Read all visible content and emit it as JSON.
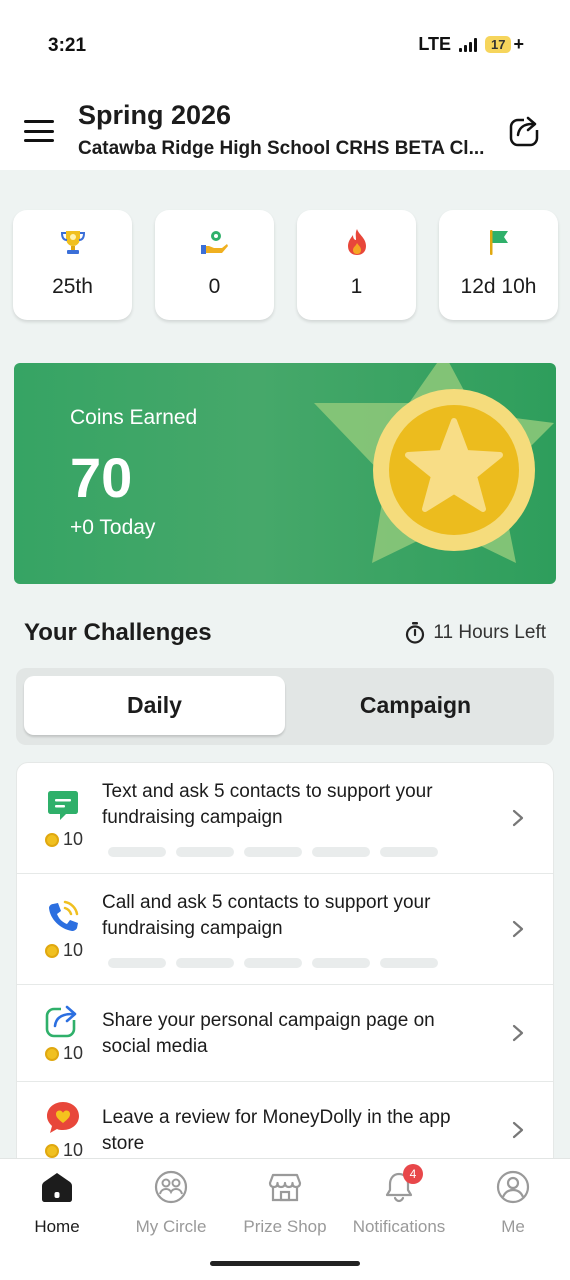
{
  "status_bar": {
    "time": "3:21",
    "network": "LTE",
    "battery": "17",
    "battery_suffix": "+"
  },
  "header": {
    "title": "Spring 2026",
    "subtitle": "Catawba Ridge High School CRHS BETA Cl...",
    "menu_icon": "hamburger-menu-icon",
    "share_icon": "share-icon"
  },
  "stats": [
    {
      "icon": "trophy-icon",
      "value": "25th"
    },
    {
      "icon": "helping-hand-icon",
      "value": "0"
    },
    {
      "icon": "flame-icon",
      "value": "1"
    },
    {
      "icon": "flag-icon",
      "value": "12d 10h"
    }
  ],
  "coins": {
    "label": "Coins Earned",
    "value": "70",
    "today": "+0 Today"
  },
  "challenges": {
    "title": "Your Challenges",
    "time_left": "11 Hours Left",
    "tabs": {
      "daily": "Daily",
      "campaign": "Campaign"
    },
    "selected_tab": "Daily",
    "items": [
      {
        "icon": "chat-icon",
        "text": "Text and ask 5 contacts to support your fundraising campaign",
        "coins": "10",
        "progress_segments": 5
      },
      {
        "icon": "phone-call-icon",
        "text": "Call and ask 5 contacts to support your fundraising campaign",
        "coins": "10",
        "progress_segments": 5
      },
      {
        "icon": "share-page-icon",
        "text": "Share your personal campaign page on social media",
        "coins": "10"
      },
      {
        "icon": "review-heart-icon",
        "text": "Leave a review for MoneyDolly in the app store",
        "coins": "10"
      }
    ]
  },
  "nav": {
    "home": "Home",
    "my_circle": "My Circle",
    "prize_shop": "Prize Shop",
    "notifications": "Notifications",
    "notifications_badge": "4",
    "me": "Me",
    "active": "Home"
  },
  "colors": {
    "accent_green": "#3aa466",
    "coin_gold": "#ecbc1e",
    "badge_red": "#e8474a"
  }
}
